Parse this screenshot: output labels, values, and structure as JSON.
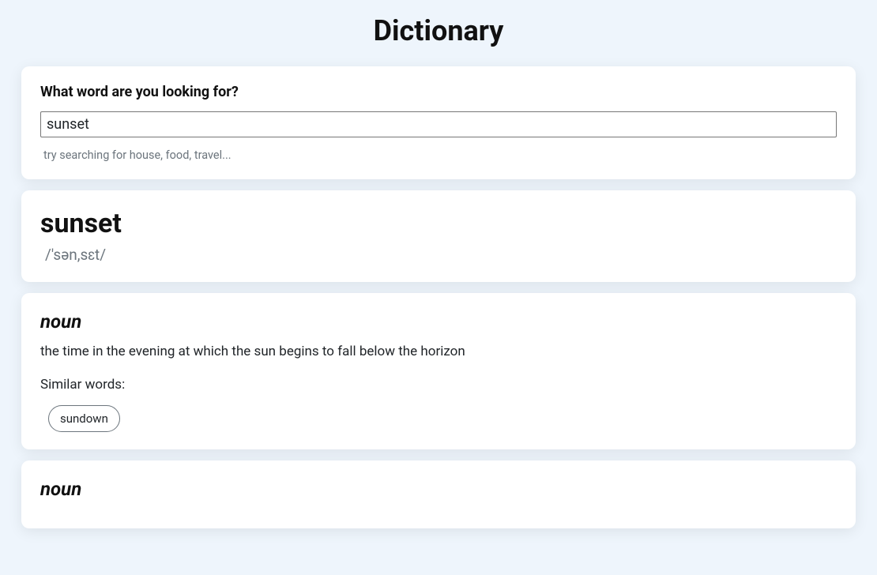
{
  "header": {
    "title": "Dictionary"
  },
  "search": {
    "label": "What word are you looking for?",
    "value": "sunset",
    "hint": "try searching for house, food, travel..."
  },
  "result": {
    "word": "sunset",
    "phonetic": "/'sən,sɛt/"
  },
  "meanings": [
    {
      "partOfSpeech": "noun",
      "definition": "the time in the evening at which the sun begins to fall below the horizon",
      "similarLabel": "Similar words:",
      "synonyms": [
        "sundown"
      ]
    },
    {
      "partOfSpeech": "noun"
    }
  ]
}
